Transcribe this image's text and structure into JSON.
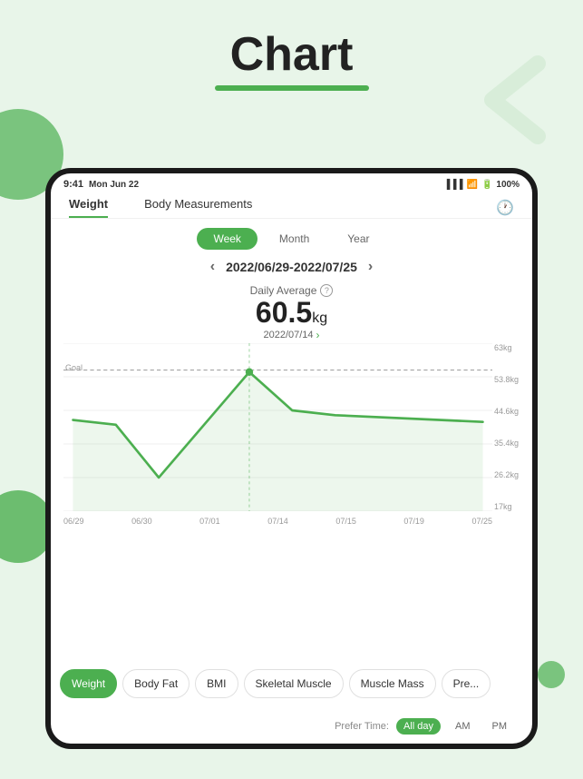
{
  "page": {
    "title": "Chart",
    "background_color": "#e8f5e9"
  },
  "status_bar": {
    "time": "9:41",
    "date": "Mon Jun 22",
    "battery": "100%",
    "signal": "●●●"
  },
  "tabs": {
    "items": [
      {
        "label": "Weight",
        "active": true
      },
      {
        "label": "Body Measurements",
        "active": false
      }
    ],
    "history_icon": "🕐"
  },
  "period_selector": {
    "options": [
      {
        "label": "Week",
        "active": true
      },
      {
        "label": "Month",
        "active": false
      },
      {
        "label": "Year",
        "active": false
      }
    ]
  },
  "date_range": {
    "value": "2022/06/29-2022/07/25",
    "prev_label": "‹",
    "next_label": "›"
  },
  "daily_average": {
    "label": "Daily Average",
    "value": "60.5",
    "unit": "kg",
    "date": "2022/07/14",
    "date_arrow": "›"
  },
  "chart": {
    "y_labels": [
      "63kg",
      "53.8kg",
      "44.6kg",
      "35.4kg",
      "26.2kg",
      "17kg"
    ],
    "x_labels": [
      "06/29",
      "06/30",
      "07/01",
      "07/14",
      "07/15",
      "07/19",
      "07/25"
    ],
    "goal_label": "Goal",
    "accent_color": "#4caf50"
  },
  "metric_tabs": [
    {
      "label": "Weight",
      "active": true
    },
    {
      "label": "Body Fat",
      "active": false
    },
    {
      "label": "BMI",
      "active": false
    },
    {
      "label": "Skeletal Muscle",
      "active": false
    },
    {
      "label": "Muscle Mass",
      "active": false
    },
    {
      "label": "Pre...",
      "active": false
    }
  ],
  "prefer_time": {
    "label": "Prefer Time:",
    "options": [
      {
        "label": "All day",
        "active": true
      },
      {
        "label": "AM",
        "active": false
      },
      {
        "label": "PM",
        "active": false
      }
    ]
  }
}
